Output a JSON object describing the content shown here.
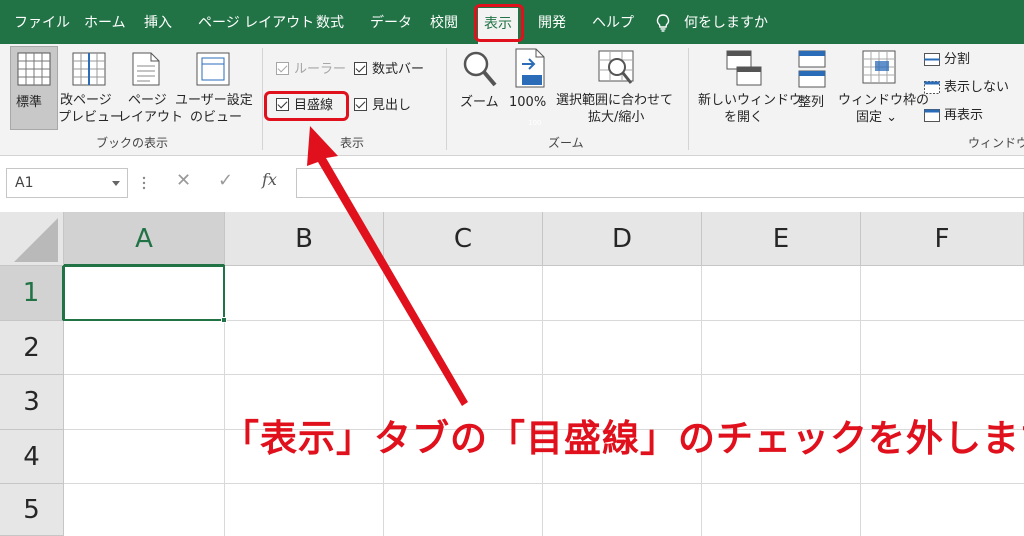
{
  "menu": {
    "tabs": [
      {
        "label": "ファイル"
      },
      {
        "label": "ホーム"
      },
      {
        "label": "挿入"
      },
      {
        "label": "ページ レイアウト"
      },
      {
        "label": "数式"
      },
      {
        "label": "データ"
      },
      {
        "label": "校閲"
      },
      {
        "label": "表示",
        "active": true
      },
      {
        "label": "開発"
      },
      {
        "label": "ヘルプ"
      }
    ],
    "tell_me": "何をしますか"
  },
  "ribbon": {
    "workbook_views": {
      "group_label": "ブックの表示",
      "normal": "標準",
      "page_break_l1": "改ページ",
      "page_break_l2": "プレビュー",
      "page_layout_l1": "ページ",
      "page_layout_l2": "レイアウト",
      "custom_l1": "ユーザー設定",
      "custom_l2": "のビュー"
    },
    "show": {
      "group_label": "表示",
      "ruler": "ルーラー",
      "formula_bar": "数式バー",
      "gridlines": "目盛線",
      "headings": "見出し"
    },
    "zoom": {
      "group_label": "ズーム",
      "zoom": "ズーム",
      "hundred": "100%",
      "badge": "100",
      "selection_l1": "選択範囲に合わせて",
      "selection_l2": "拡大/縮小"
    },
    "window": {
      "group_label": "ウィンドウ",
      "new_window_l1": "新しいウィンドウ",
      "new_window_l2": "を開く",
      "arrange": "整列",
      "freeze_l1": "ウィンドウ枠の",
      "freeze_l2": "固定 ⌄",
      "split": "分割",
      "hide": "表示しない",
      "unhide": "再表示"
    }
  },
  "formula_bar": {
    "name_box": "A1",
    "cancel": "✕",
    "enter": "✓",
    "fx": "fx"
  },
  "grid": {
    "columns": [
      "A",
      "B",
      "C",
      "D",
      "E",
      "F"
    ],
    "rows": [
      "1",
      "2",
      "3",
      "4",
      "5"
    ]
  },
  "annotation": {
    "text": "「表示」タブの「目盛線」のチェックを外します"
  },
  "colors": {
    "excel_green": "#217346",
    "highlight_red": "#e0101c"
  }
}
